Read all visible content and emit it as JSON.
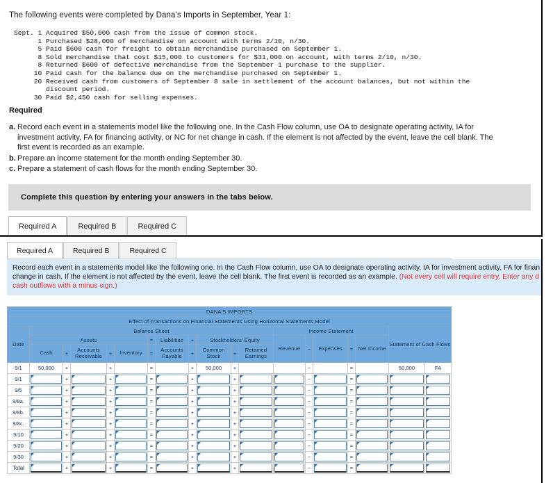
{
  "question": {
    "intro": "The following events were completed by Dana's Imports in September, Year 1:",
    "events": [
      "Sept. 1 Acquired $50,000 cash from the issue of common stock.",
      "      1 Purchased $28,000 of merchandise on account with terms 2/10, n/30.",
      "      5 Paid $600 cash for freight to obtain merchandise purchased on September 1.",
      "      8 Sold merchandise that cost $15,000 to customers for $31,000 on account, with terms 2/10, n/30.",
      "      8 Returned $600 of defective merchandise from the September 1 purchase to the supplier.",
      "     10 Paid cash for the balance due on the merchandise purchased on September 1.",
      "     20 Received cash from customers of September 8 sale in settlement of the account balances, but not within the",
      "        discount period.",
      "     30 Paid $2,450 cash for selling expenses."
    ],
    "required_heading": "Required",
    "required_items": [
      {
        "label": "a.",
        "text": "Record each event in a statements model like the following one. In the Cash Flow column, use OA to designate operating activity, IA for investment activity, FA for financing activity, or NC for net change in cash. If the element is not affected by the event, leave the cell blank. The first event is recorded as an example."
      },
      {
        "label": "b.",
        "text": "Prepare an income statement for the month ending September 30."
      },
      {
        "label": "c.",
        "text": "Prepare a statement of cash flows for the month ending September 30."
      }
    ],
    "banner": "Complete this question by entering your answers in the tabs below."
  },
  "tabs_upper": [
    {
      "label": "Required A",
      "active": true
    },
    {
      "label": "Required B",
      "active": false
    },
    {
      "label": "Required C",
      "active": false
    }
  ],
  "tabs_lower": [
    {
      "label": "Required A",
      "active": true
    },
    {
      "label": "Required B",
      "active": false
    },
    {
      "label": "Required C",
      "active": false
    }
  ],
  "answer_panel": {
    "instruction_black_1": "Record each event in a statements model like the following one. In the Cash Flow column, use OA to designate operating activity, IA for investment activity, FA for finan",
    "instruction_black_2": "change in cash. If the element is not affected by the event, leave the cell blank. The first event is recorded as an example. ",
    "instruction_red_1": "(Not every cell will require entry. Enter any d",
    "instruction_red_2": "and cash outflows with a minus sign.)"
  },
  "worksheet": {
    "company": "DANA'S IMPORTS",
    "subtitle": "Effect of Transactions on Financial Statements Using Horizontal Statements Model",
    "groups": {
      "balance_sheet": "Balance Sheet",
      "income_statement": "Income Statement"
    },
    "subgroups": {
      "assets": "Assets",
      "liabilities": "Liabilities",
      "equity": "Stockholders' Equity"
    },
    "columns": {
      "date": "Date",
      "cash": "Cash",
      "accounts_receivable": "Accounts Receivable",
      "inventory": "Inventory",
      "accounts_payable": "Accounts Payable",
      "common_stock": "Common Stock",
      "retained_earnings": "Retained Earnings",
      "revenue": "Revenue",
      "expenses": "Expenses",
      "net_income": "Net Income",
      "cash_flows": "Statement of Cash Flows"
    },
    "operators": {
      "plus": "+",
      "equals": "=",
      "minus": "−"
    },
    "rows": [
      {
        "date": "9/1",
        "example": true,
        "cash": "50,000",
        "accounts_receivable": "",
        "inventory": "",
        "accounts_payable": "",
        "common_stock": "50,000",
        "retained_earnings": "",
        "revenue": "",
        "expenses": "",
        "net_income": "",
        "cash_flow_amount": "50,000",
        "cash_flow_code": "FA"
      },
      {
        "date": "9/1",
        "example": false
      },
      {
        "date": "9/5",
        "example": false
      },
      {
        "date": "9/8a.",
        "example": false
      },
      {
        "date": "9/8b.",
        "example": false
      },
      {
        "date": "9/8c.",
        "example": false
      },
      {
        "date": "9/10",
        "example": false
      },
      {
        "date": "9/20",
        "example": false
      },
      {
        "date": "9/30",
        "example": false
      },
      {
        "date": "Total",
        "example": false,
        "total": true
      }
    ]
  },
  "colors": {
    "header_blue": "#6fa8dc",
    "banner_light_blue": "#d9eaf8",
    "banner_grey": "#dcdcdc",
    "red_text": "#e03232",
    "cell_border_blue": "#4a7db5"
  }
}
